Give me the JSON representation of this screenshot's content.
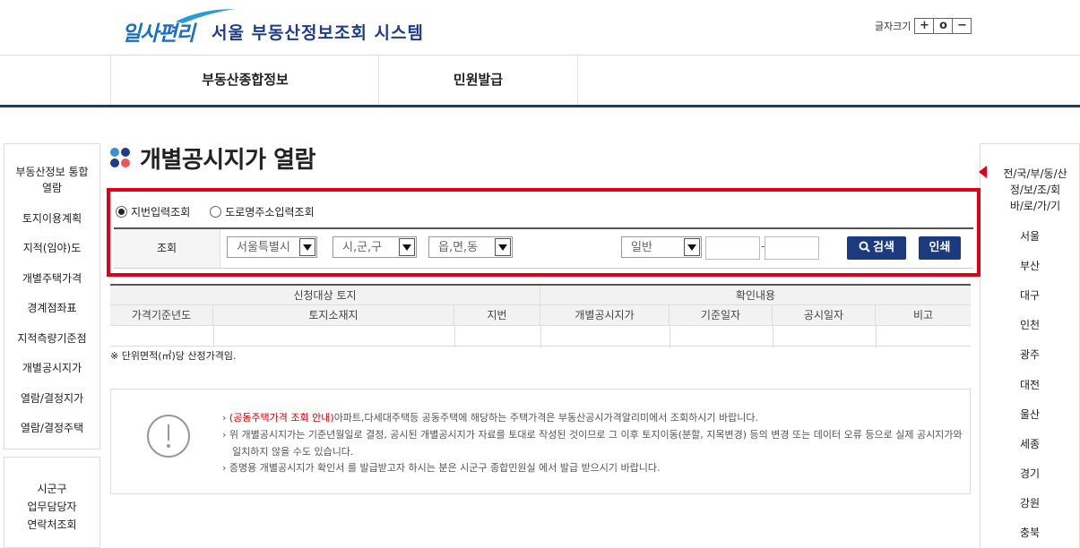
{
  "header": {
    "logo_brand": "일사편리",
    "system_title": "서울 부동산정보조회 시스템",
    "font_size_label": "글자크기",
    "font_size_buttons": [
      "+",
      "o",
      "−"
    ]
  },
  "gnb": {
    "menu1": "부동산종합정보",
    "menu2": "민원발급"
  },
  "left_nav": {
    "items": [
      "부동산정보 통합\n열람",
      "토지이용계획",
      "지적(임야)도",
      "개별주택가격",
      "경계점좌표",
      "지적측량기준점",
      "개별공시지가",
      "열람/결정지가",
      "열람/결정주택"
    ],
    "contact": "시군구\n업무담당자\n연락처조회"
  },
  "right_nav": {
    "title": "전/국/부/동/산\n정/보/조/회\n바/로/가/기",
    "cities": [
      "서울",
      "부산",
      "대구",
      "인천",
      "광주",
      "대전",
      "울산",
      "세종",
      "경기",
      "강원",
      "충북"
    ]
  },
  "page_title": "개별공시지가 열람",
  "search": {
    "radio_jibun": "지번입력조회",
    "radio_road": "도로명주소입력조회",
    "row_label": "조회",
    "sido": "서울특별시",
    "sigungu": "시,군,구",
    "dong": "읍,면,동",
    "type": "일반",
    "dash": "-",
    "search_button": "검색",
    "print_button": "인쇄"
  },
  "result_table": {
    "group1": "신청대상 토지",
    "group2": "확인내용",
    "columns": [
      "가격기준년도",
      "토지소재지",
      "지번",
      "개별공시지가",
      "기준일자",
      "공시일자",
      "비고"
    ]
  },
  "note": "※ 단위면적(㎡)당 산정가격임.",
  "info": {
    "line1_red": "(공동주택가격 조회 안내)",
    "line1_rest": "아파트,다세대주택등 공동주택에 해당하는 주택가격은 부동산공시가격알리미에서 조회하시기 바랍니다.",
    "line2": "위 개별공시지가는 기준년월일로 결정, 공시된 개별공시지가 자료를 토대로 작성된 것이므로 그 이후 토지이동(분할, 지목변경) 등의 변경 또는 데이터 오류 등으로 실제 공시지가와",
    "line3": "일치하지 않을 수도 있습니다.",
    "line4": "증명용 개별공시지가 확인서 를 발급받고자 하시는 분은 시군구 종합민원실 에서 발급 받으시기 바랍니다.",
    "bullet": "›"
  },
  "colors": {
    "navy": "#1b3a80",
    "highlight_red": "#e0001b",
    "logo_blue": "#1a6fc4"
  }
}
